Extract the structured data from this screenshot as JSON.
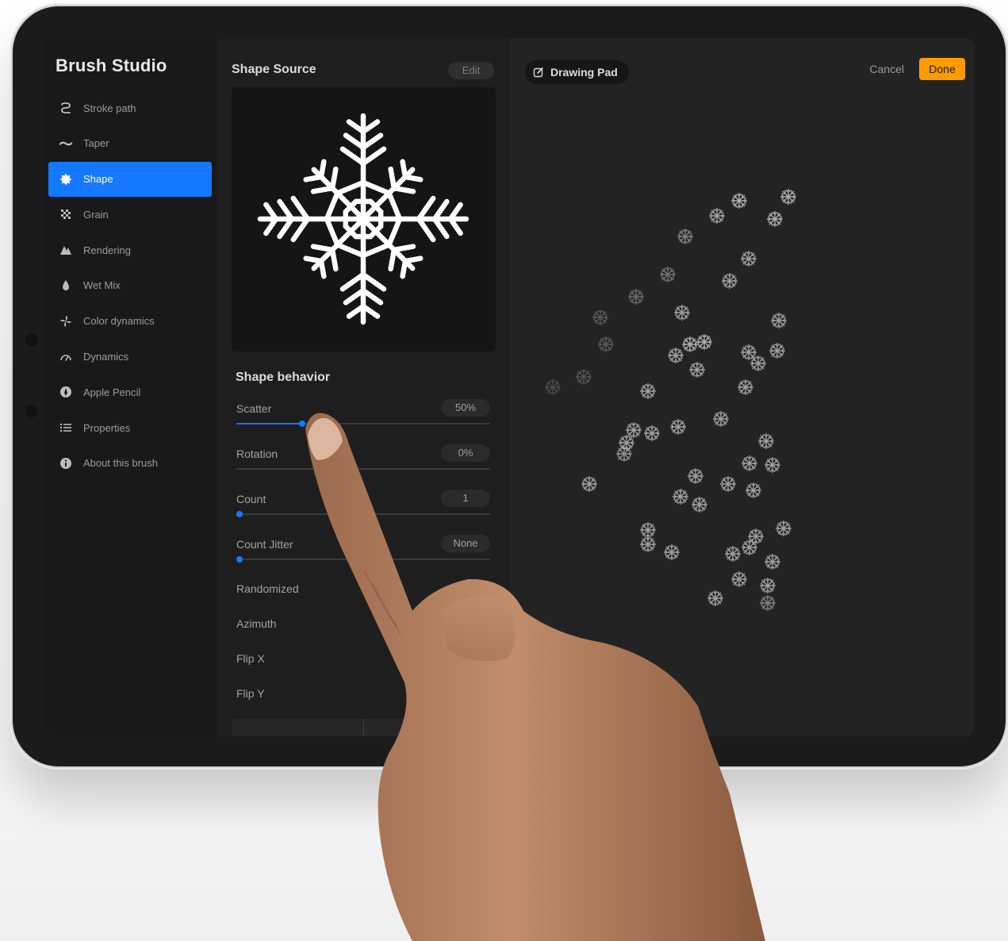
{
  "sidebar": {
    "title": "Brush Studio",
    "items": [
      {
        "label": "Stroke path",
        "icon": "stroke-path-icon",
        "active": false
      },
      {
        "label": "Taper",
        "icon": "taper-icon",
        "active": false
      },
      {
        "label": "Shape",
        "icon": "shape-icon",
        "active": true
      },
      {
        "label": "Grain",
        "icon": "grain-icon",
        "active": false
      },
      {
        "label": "Rendering",
        "icon": "rendering-icon",
        "active": false
      },
      {
        "label": "Wet Mix",
        "icon": "wet-mix-icon",
        "active": false
      },
      {
        "label": "Color dynamics",
        "icon": "color-dynamics-icon",
        "active": false
      },
      {
        "label": "Dynamics",
        "icon": "dynamics-icon",
        "active": false
      },
      {
        "label": "Apple Pencil",
        "icon": "apple-pencil-icon",
        "active": false
      },
      {
        "label": "Properties",
        "icon": "properties-icon",
        "active": false
      },
      {
        "label": "About this brush",
        "icon": "info-icon",
        "active": false
      }
    ]
  },
  "shape_source": {
    "title": "Shape Source",
    "edit_label": "Edit",
    "preview_icon": "snowflake-icon"
  },
  "shape_behavior": {
    "title": "Shape behavior",
    "sliders": [
      {
        "label": "Scatter",
        "value_text": "50%",
        "level": 0.26
      },
      {
        "label": "Rotation",
        "value_text": "0%",
        "level": 0.0
      },
      {
        "label": "Count",
        "value_text": "1",
        "level": 0.0
      },
      {
        "label": "Count Jitter",
        "value_text": "None",
        "level": 0.0
      }
    ],
    "toggles": [
      "Randomized",
      "Azimuth",
      "Flip X",
      "Flip Y"
    ]
  },
  "drawing_pad": {
    "label": "Drawing Pad",
    "icon": "edit-pencil-icon",
    "cancel_label": "Cancel",
    "done_label": "Done"
  },
  "colors": {
    "accent": "#1479ff",
    "done": "#ff9a00",
    "sidebar_bg": "#191919",
    "panel_bg": "#1e1e1e",
    "canvas_bg": "#232323"
  }
}
